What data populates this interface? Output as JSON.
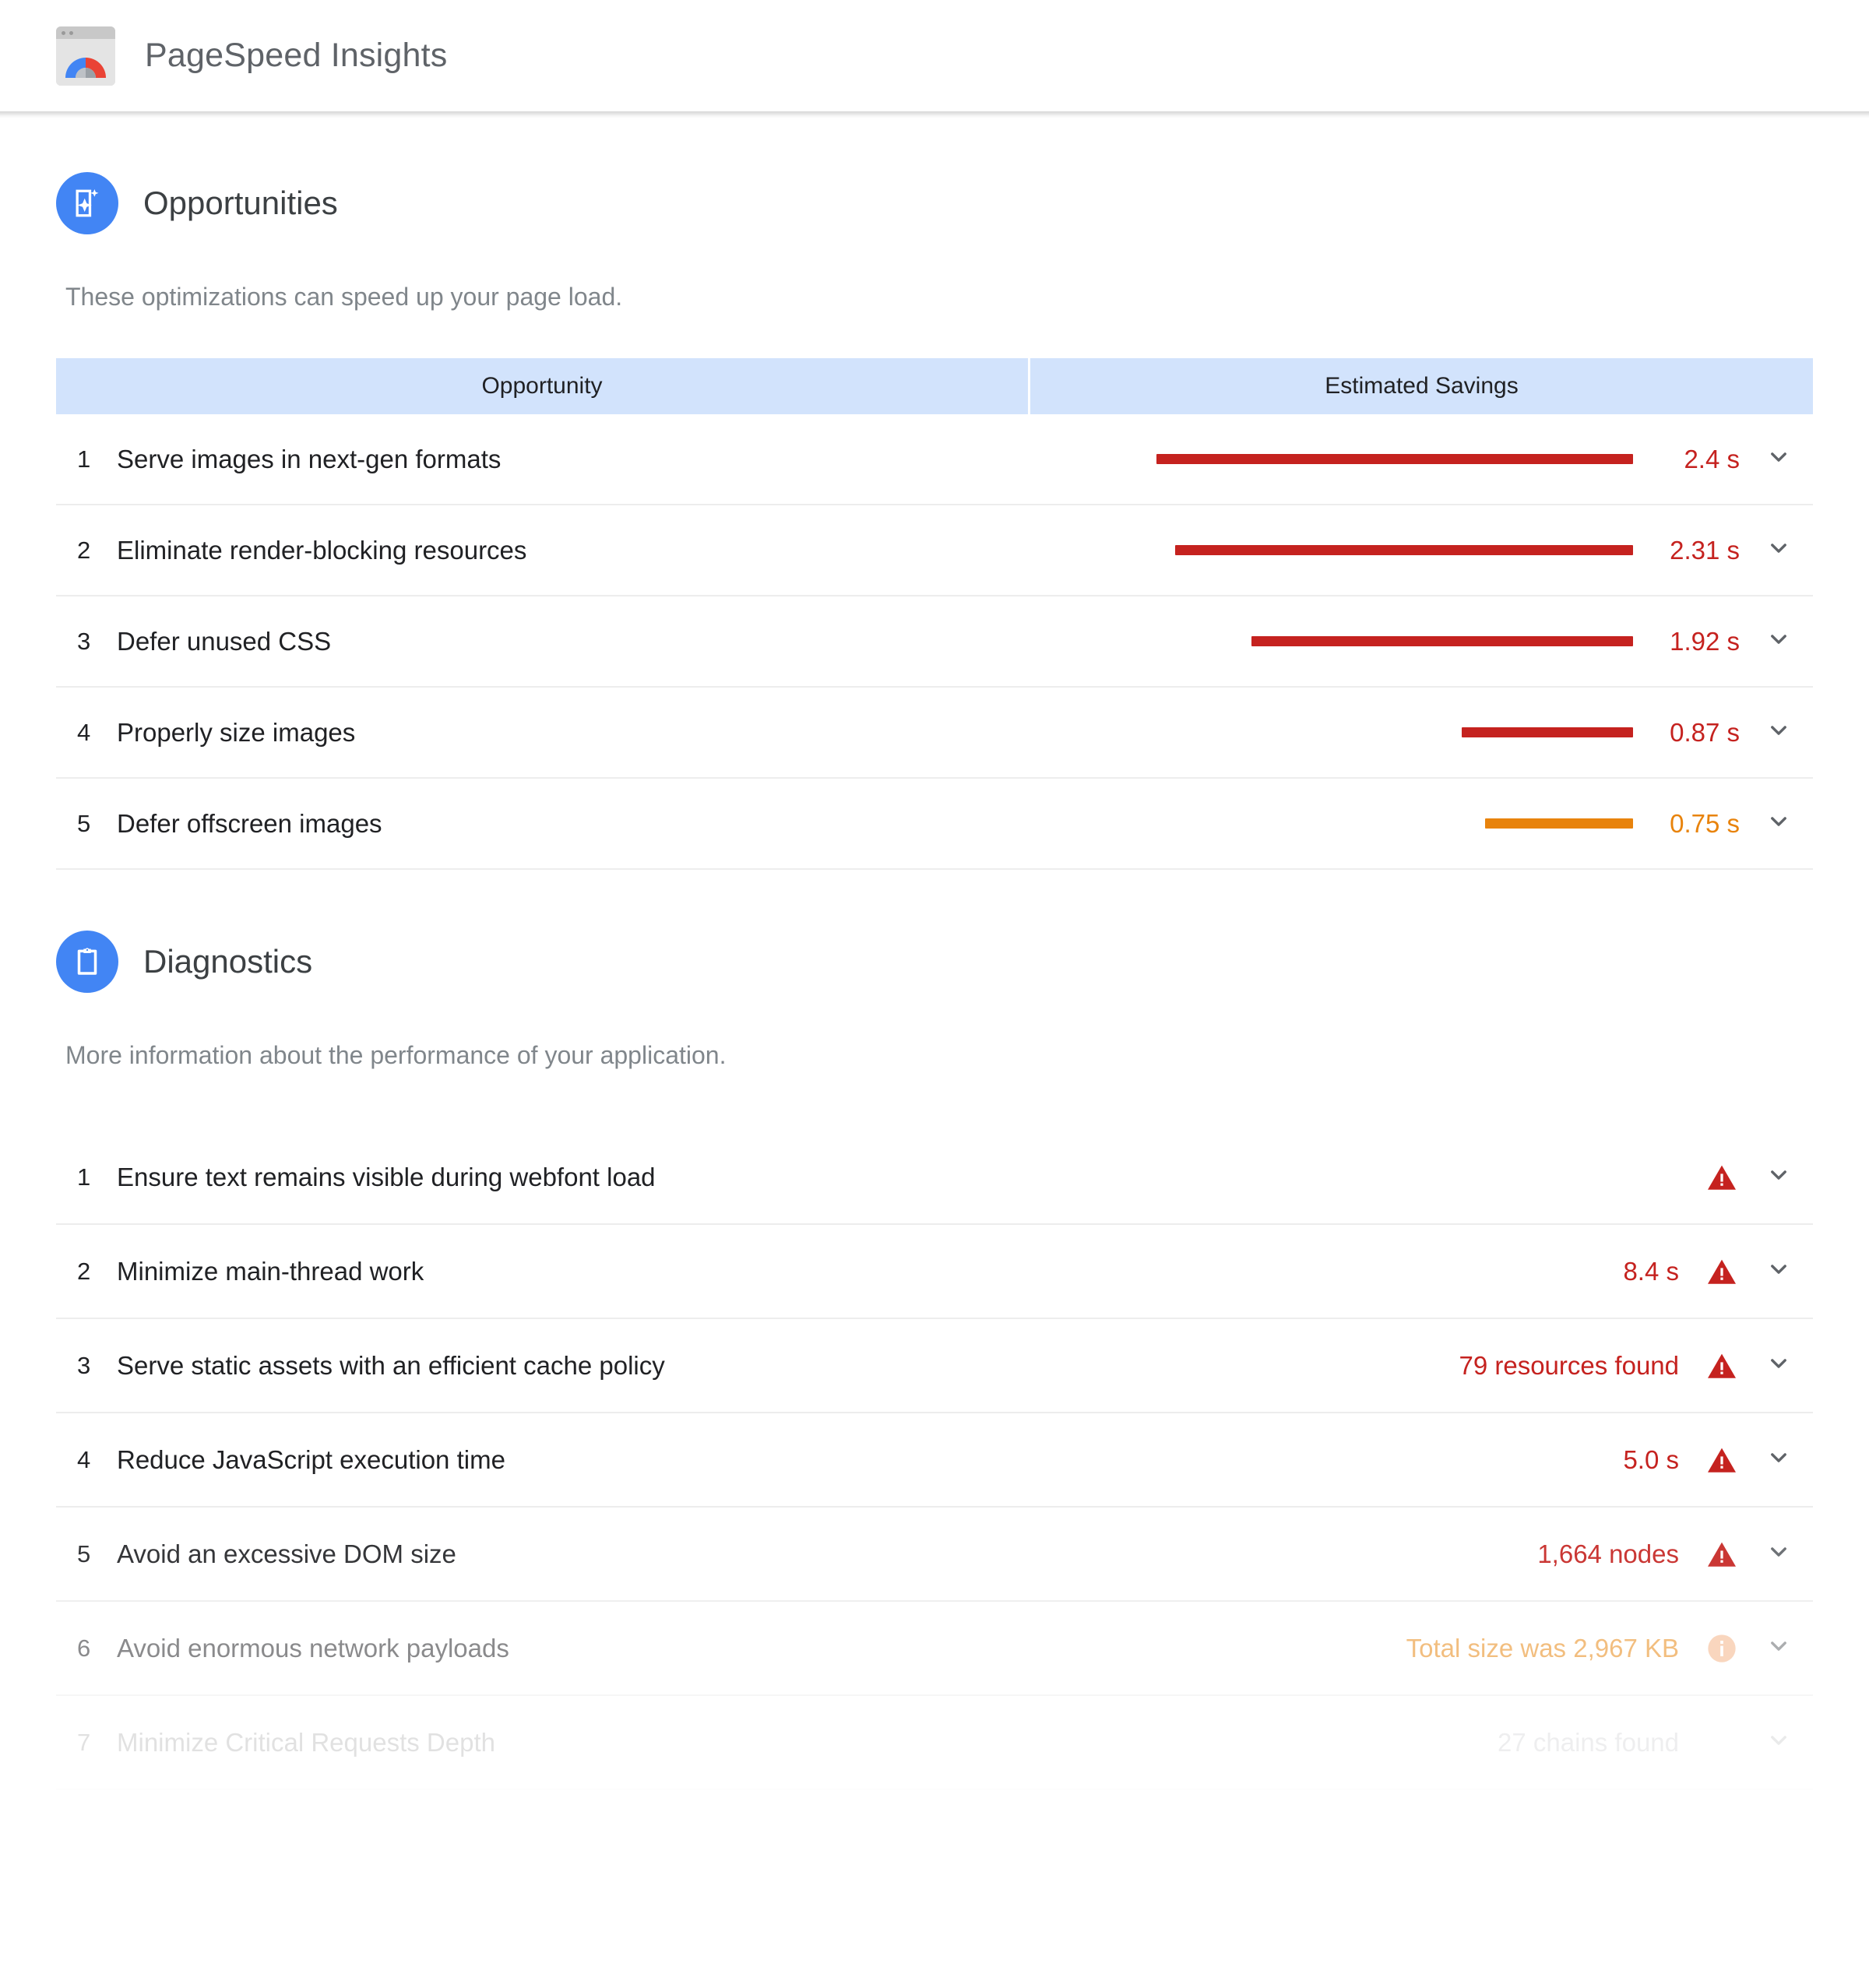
{
  "app": {
    "title": "PageSpeed Insights",
    "logo_icon": "pagespeed-gauge-icon"
  },
  "colors": {
    "accent_blue": "#4285f4",
    "header_blue": "#d2e3fc",
    "red": "#c5221f",
    "orange": "#e8830c",
    "text_primary": "#202124",
    "text_secondary": "#80868b"
  },
  "opportunities": {
    "icon": "opportunities-sparkle-doc-icon",
    "title": "Opportunities",
    "description": "These optimizations can speed up your page load.",
    "columns": [
      "Opportunity",
      "Estimated Savings"
    ],
    "rows": [
      {
        "index": "1",
        "name": "Serve images in next-gen formats",
        "value": "2.4 s",
        "seconds": 2.4,
        "severity": "red",
        "bar_pct": 100
      },
      {
        "index": "2",
        "name": "Eliminate render-blocking resources",
        "value": "2.31 s",
        "seconds": 2.31,
        "severity": "red",
        "bar_pct": 96
      },
      {
        "index": "3",
        "name": "Defer unused CSS",
        "value": "1.92 s",
        "seconds": 1.92,
        "severity": "red",
        "bar_pct": 80
      },
      {
        "index": "4",
        "name": "Properly size images",
        "value": "0.87 s",
        "seconds": 0.87,
        "severity": "red",
        "bar_pct": 36
      },
      {
        "index": "5",
        "name": "Defer offscreen images",
        "value": "0.75 s",
        "seconds": 0.75,
        "severity": "orange",
        "bar_pct": 31
      }
    ]
  },
  "diagnostics": {
    "icon": "diagnostics-clipboard-icon",
    "title": "Diagnostics",
    "description": "More information about the performance of your application.",
    "rows": [
      {
        "index": "1",
        "name": "Ensure text remains visible during webfont load",
        "value": "",
        "badge": "error-triangle-icon",
        "severity": "red",
        "fade": "none"
      },
      {
        "index": "2",
        "name": "Minimize main-thread work",
        "value": "8.4 s",
        "badge": "error-triangle-icon",
        "severity": "red",
        "fade": "none"
      },
      {
        "index": "3",
        "name": "Serve static assets with an efficient cache policy",
        "value": "79 resources found",
        "badge": "error-triangle-icon",
        "severity": "red",
        "fade": "none"
      },
      {
        "index": "4",
        "name": "Reduce JavaScript execution time",
        "value": "5.0 s",
        "badge": "error-triangle-icon",
        "severity": "red",
        "fade": "none"
      },
      {
        "index": "5",
        "name": "Avoid an excessive DOM size",
        "value": "1,664 nodes",
        "badge": "error-triangle-icon",
        "severity": "red",
        "fade": "light"
      },
      {
        "index": "6",
        "name": "Avoid enormous network payloads",
        "value": "Total size was 2,967 KB",
        "badge": "info-circle-icon",
        "severity": "orange",
        "fade": "medium"
      },
      {
        "index": "7",
        "name": "Minimize Critical Requests Depth",
        "value": "27 chains found",
        "badge": "none",
        "severity": "none",
        "fade": "heavy"
      }
    ]
  },
  "icons": {
    "expand_chevron": "chevron-down-icon"
  }
}
